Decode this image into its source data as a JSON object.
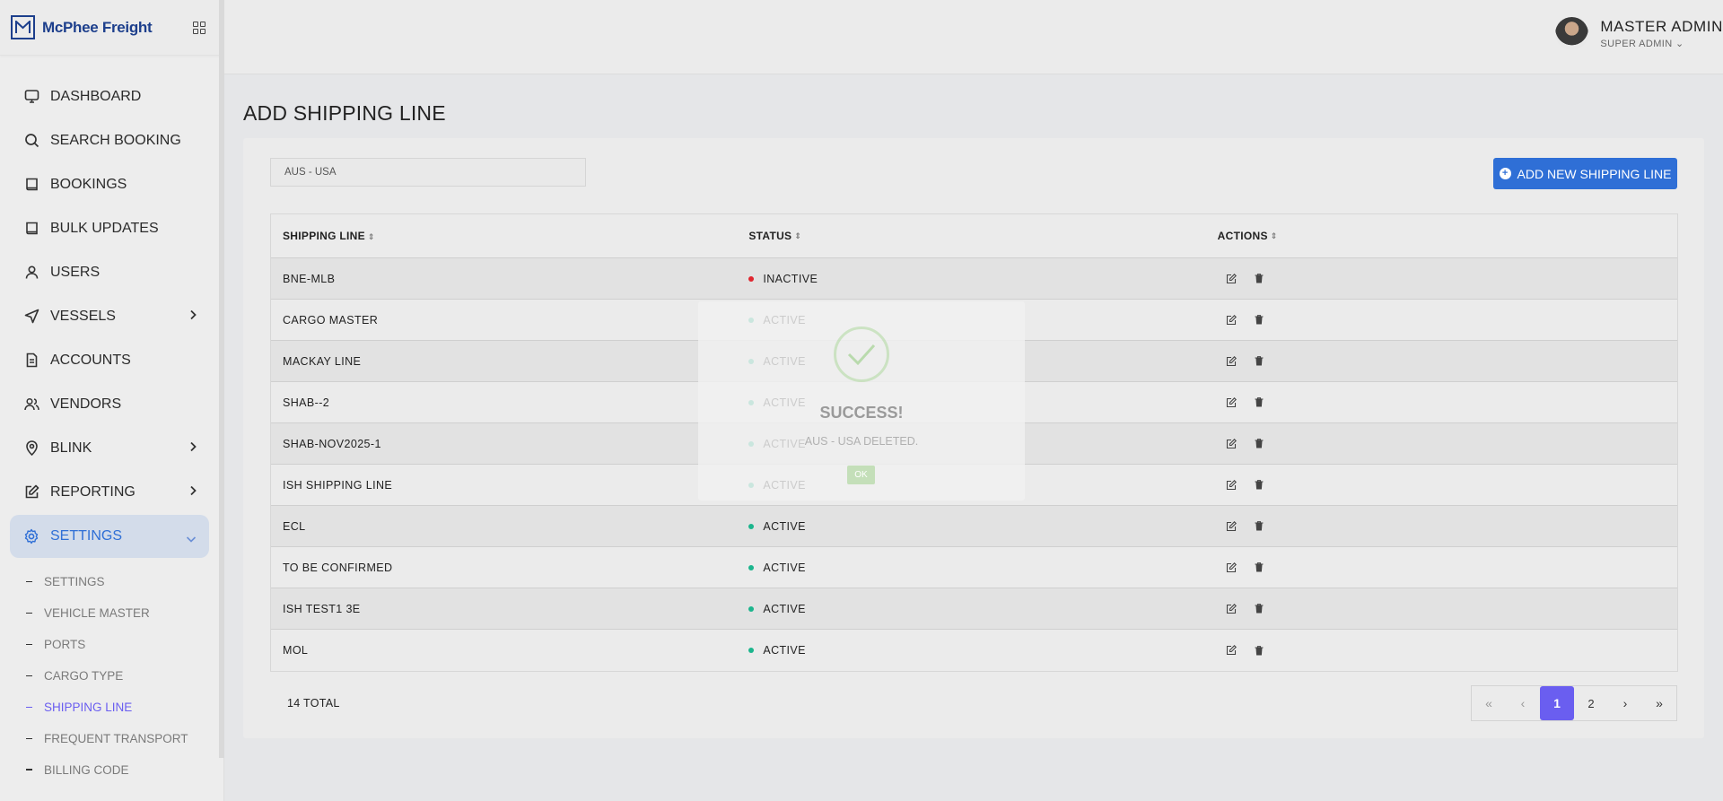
{
  "brand": {
    "name": "McPhee Freight"
  },
  "sidebar": {
    "items": [
      {
        "label": "DASHBOARD",
        "icon": "monitor-icon"
      },
      {
        "label": "SEARCH BOOKING",
        "icon": "search-icon"
      },
      {
        "label": "BOOKINGS",
        "icon": "book-icon"
      },
      {
        "label": "BULK UPDATES",
        "icon": "book-icon"
      },
      {
        "label": "USERS",
        "icon": "user-icon"
      },
      {
        "label": "VESSELS",
        "icon": "send-icon"
      },
      {
        "label": "ACCOUNTS",
        "icon": "document-icon"
      },
      {
        "label": "VENDORS",
        "icon": "users-icon"
      },
      {
        "label": "BLINK",
        "icon": "location-pin-icon"
      },
      {
        "label": "REPORTING",
        "icon": "edit-icon"
      },
      {
        "label": "SETTINGS",
        "icon": "gear-icon"
      }
    ],
    "subitems": [
      "SETTINGS",
      "VEHICLE MASTER",
      "PORTS",
      "CARGO TYPE",
      "SHIPPING LINE",
      "FREQUENT TRANSPORT",
      "BILLING CODE"
    ],
    "accent": "#2f6fd6",
    "sub_accent": "#6a5ef0"
  },
  "header": {
    "user_name": "MASTER ADMIN",
    "user_role": "SUPER ADMIN ⌄"
  },
  "page": {
    "title": "ADD SHIPPING LINE"
  },
  "search": {
    "value": "AUS - USA"
  },
  "toolbar": {
    "add_label": "ADD NEW SHIPPING LINE",
    "add_icon": "plus-circle-icon"
  },
  "table": {
    "headers": [
      "SHIPPING LINE",
      "STATUS",
      "ACTIONS"
    ],
    "rows": [
      {
        "name": "BNE-MLB",
        "status": "INACTIVE"
      },
      {
        "name": "CARGO MASTER",
        "status": "ACTIVE"
      },
      {
        "name": "MACKAY LINE",
        "status": "ACTIVE"
      },
      {
        "name": "SHAB--2",
        "status": "ACTIVE"
      },
      {
        "name": "SHAB-NOV2025-1",
        "status": "ACTIVE"
      },
      {
        "name": "ISH SHIPPING LINE",
        "status": "ACTIVE"
      },
      {
        "name": "ECL",
        "status": "ACTIVE"
      },
      {
        "name": "TO BE CONFIRMED",
        "status": "ACTIVE"
      },
      {
        "name": "ISH TEST1 3E",
        "status": "ACTIVE"
      },
      {
        "name": "MOL",
        "status": "ACTIVE"
      }
    ]
  },
  "footer": {
    "total": "14 TOTAL"
  },
  "pagination": {
    "first": "«",
    "prev": "‹",
    "pages": [
      "1",
      "2"
    ],
    "next": "›",
    "last": "»",
    "current": "1"
  },
  "modal": {
    "title": "SUCCESS!",
    "message": "AUS - USA DELETED.",
    "ok_label": "OK"
  }
}
